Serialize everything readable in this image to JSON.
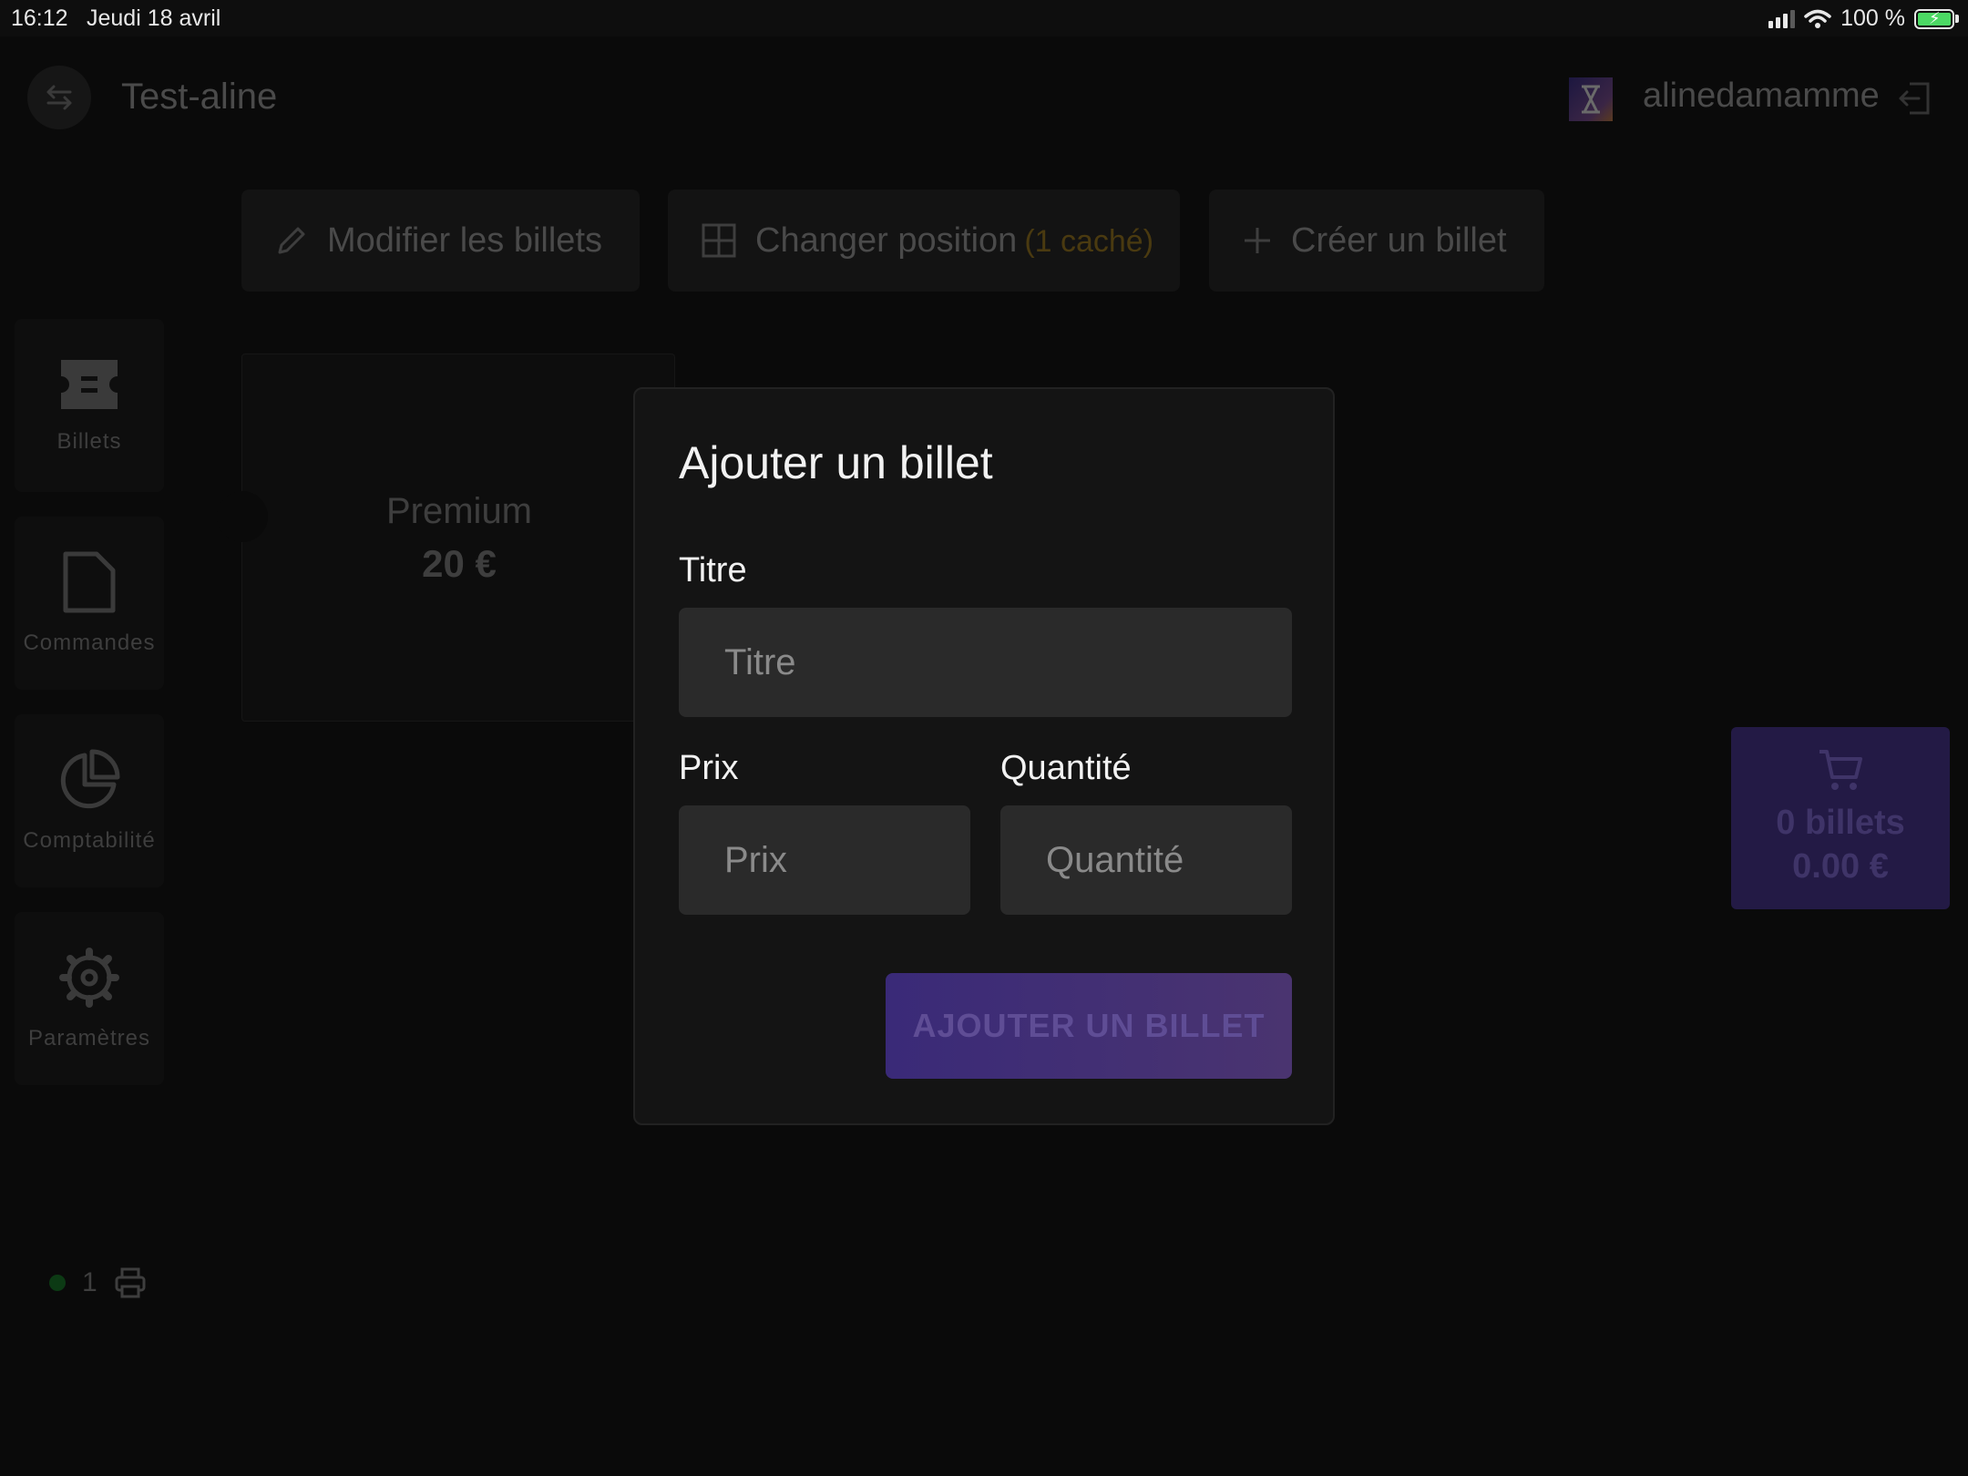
{
  "status_bar": {
    "time": "16:12",
    "date": "Jeudi 18 avril",
    "battery": "100 %"
  },
  "header": {
    "title": "Test-aline",
    "username": "alinedamamme"
  },
  "actions": {
    "edit_label": "Modifier les billets",
    "reorder_label": "Changer position",
    "reorder_hidden": "(1 caché)",
    "create_label": "Créer un billet"
  },
  "sidebar": {
    "items": [
      {
        "label": "Billets"
      },
      {
        "label": "Commandes"
      },
      {
        "label": "Comptabilité"
      },
      {
        "label": "Paramètres"
      }
    ]
  },
  "tickets": [
    {
      "name": "Premium",
      "price": "20 €"
    }
  ],
  "cart": {
    "count": "0 billets",
    "total": "0.00 €"
  },
  "printers": {
    "count": "1"
  },
  "modal": {
    "title": "Ajouter un billet",
    "title_label": "Titre",
    "title_placeholder": "Titre",
    "price_label": "Prix",
    "price_placeholder": "Prix",
    "quantity_label": "Quantité",
    "quantity_placeholder": "Quantité",
    "submit_label": "AJOUTER UN BILLET"
  },
  "colors": {
    "accent": "#5a3fc0",
    "background": "#000000",
    "modal_bg": "#141414",
    "input_bg": "#2a2a2a",
    "hidden_count": "#c79a2a",
    "printer_online": "#1ec73a"
  }
}
